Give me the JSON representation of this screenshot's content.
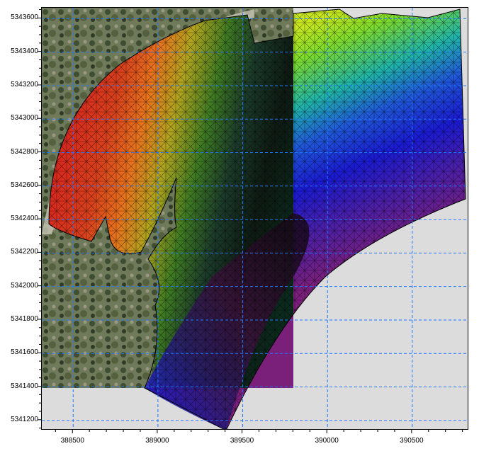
{
  "chart_data": {
    "type": "map",
    "x_ticks": [
      "388500",
      "389000",
      "389500",
      "390000",
      "390500"
    ],
    "y_ticks": [
      "5343600",
      "5343400",
      "5343200",
      "5343000",
      "5342800",
      "5342600",
      "5342400",
      "5342200",
      "5342000",
      "5341800",
      "5341600",
      "5341400",
      "5341200"
    ],
    "x_tick_values": [
      388500,
      389000,
      389500,
      390000,
      390500
    ],
    "y_tick_values": [
      5343600,
      5343400,
      5343200,
      5343000,
      5342800,
      5342600,
      5342400,
      5342200,
      5342000,
      5341800,
      5341600,
      5341400,
      5341200
    ],
    "xlim": [
      388315,
      390835
    ],
    "ylim": [
      5341140,
      5343665
    ],
    "grid": true,
    "grid_style": "dashed",
    "grid_color": "#1e78ff",
    "imagery_extent": {
      "x": [
        388315,
        389800
      ],
      "y": [
        5341400,
        5343665
      ]
    },
    "colormap": [
      "#d7261e",
      "#e8731c",
      "#c8c61e",
      "#7fdc2a",
      "#2aa84c",
      "#1b3a2a",
      "#1fb5a8",
      "#1f58d8",
      "#1a1ad2",
      "#4a1fa8",
      "#7a1f7a"
    ]
  }
}
